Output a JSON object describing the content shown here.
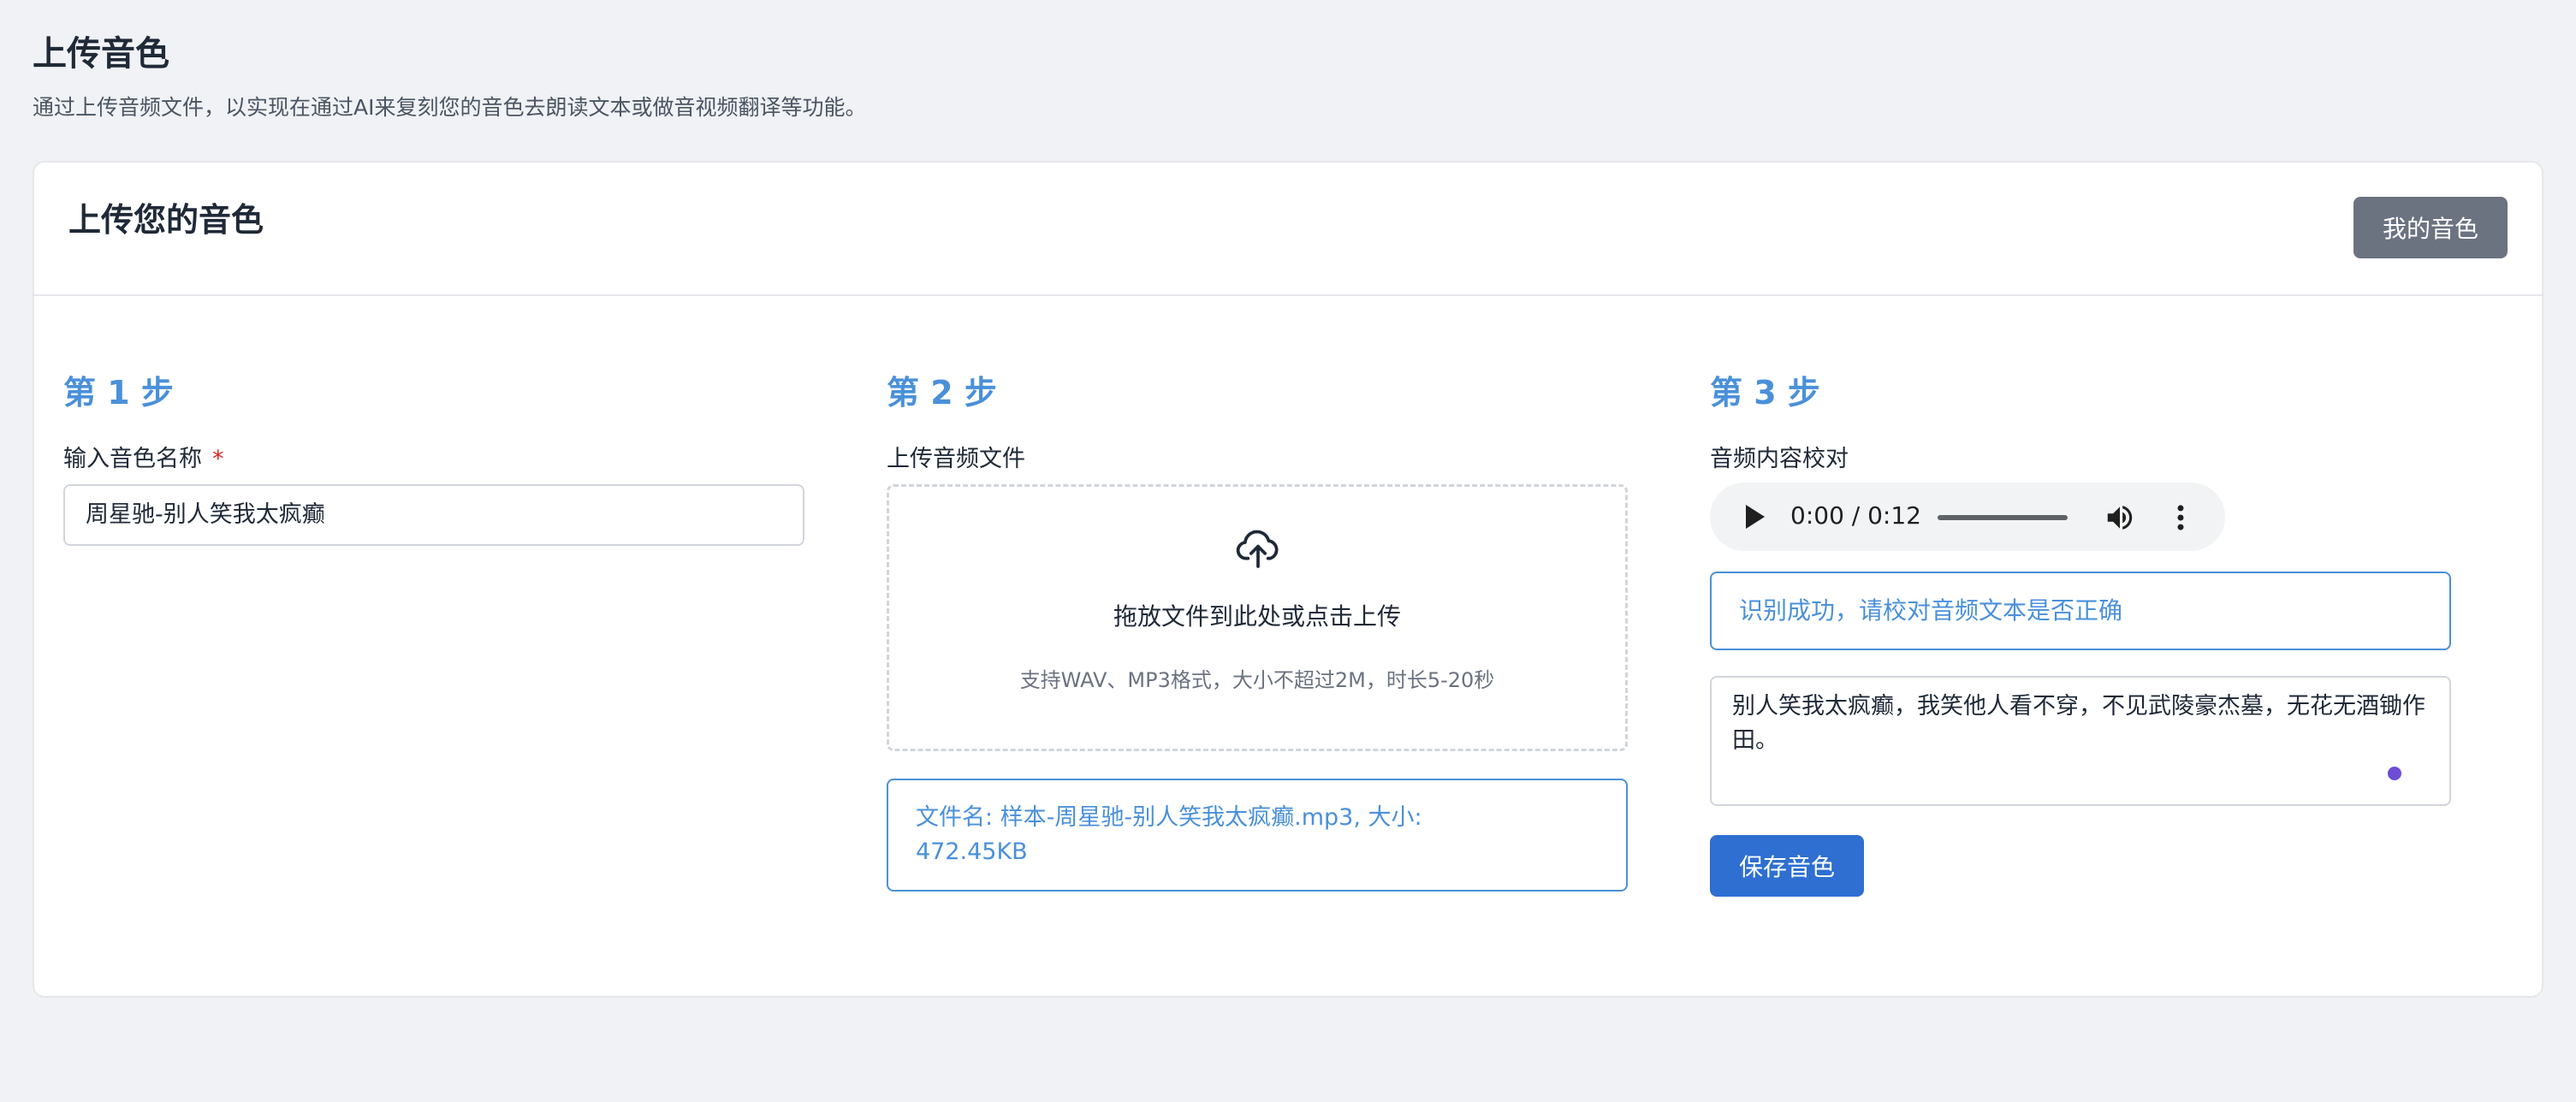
{
  "page": {
    "title": "上传音色",
    "subtitle": "通过上传音频文件，以实现在通过AI来复刻您的音色去朗读文本或做音视频翻译等功能。"
  },
  "card": {
    "title": "上传您的音色",
    "my_voice_button": "我的音色"
  },
  "step1": {
    "title": "第 1 步",
    "label": "输入音色名称",
    "required_mark": "*",
    "input_value": "周星驰-别人笑我太疯癫"
  },
  "step2": {
    "title": "第 2 步",
    "label": "上传音频文件",
    "dropzone_title": "拖放文件到此处或点击上传",
    "dropzone_hint": "支持WAV、MP3格式，大小不超过2M，时长5-20秒",
    "upload_icon": "cloud-upload-icon",
    "file_info_line1": "文件名: 样本-周星驰-别人笑我太疯癫.mp3, 大小:",
    "file_info_line2": "472.45KB"
  },
  "step3": {
    "title": "第 3 步",
    "label": "音频内容校对",
    "audio_time": "0:00 / 0:12",
    "recognized_text": "识别成功，请校对音频文本是否正确",
    "transcript": "别人笑我太疯癫，我笑他人看不穿，不见武陵豪杰墓，无花无酒锄作田。",
    "save_button": "保存音色"
  },
  "colors": {
    "accent": "#4a90d9",
    "primary_button": "#2e6fd1",
    "secondary_button": "#6b7280",
    "background": "#f0f2f5"
  }
}
